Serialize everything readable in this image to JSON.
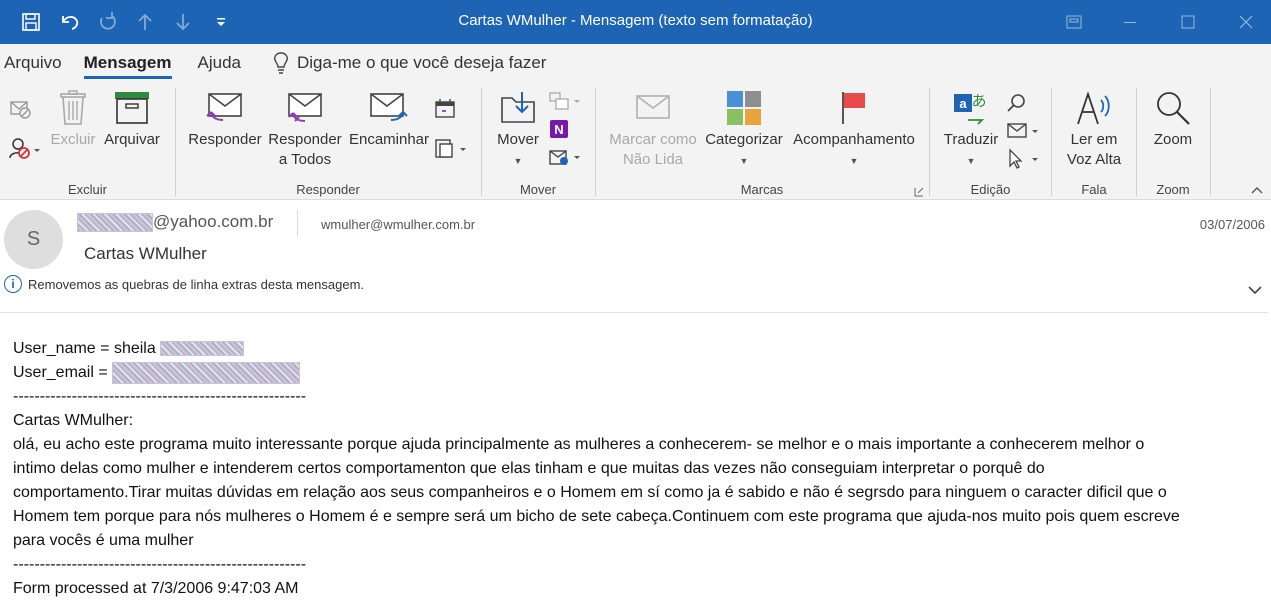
{
  "window": {
    "title": "Cartas WMulher  -  Mensagem (texto sem formatação)"
  },
  "tabs": [
    {
      "label": "Arquivo"
    },
    {
      "label": "Mensagem"
    },
    {
      "label": "Ajuda"
    }
  ],
  "tellme": {
    "label": "Diga-me o que você deseja fazer"
  },
  "ribbon": {
    "groups": {
      "excluir": "Excluir",
      "responder": "Responder",
      "mover": "Mover",
      "marcas": "Marcas",
      "edicao": "Edição",
      "fala": "Fala",
      "zoom": "Zoom"
    },
    "buttons": {
      "excluir": "Excluir",
      "arquivar": "Arquivar",
      "responder": "Responder",
      "responder_todos_1": "Responder",
      "responder_todos_2": "a Todos",
      "encaminhar": "Encaminhar",
      "mover": "Mover",
      "marcar_1": "Marcar como",
      "marcar_2": "Não Lida",
      "categorizar": "Categorizar",
      "acompanhamento": "Acompanhamento",
      "traduzir": "Traduzir",
      "ler_1": "Ler em",
      "ler_2": "Voz Alta",
      "zoom": "Zoom"
    }
  },
  "message": {
    "avatar_initial": "S",
    "from_domain": "@yahoo.com.br",
    "to": "wmulher@wmulher.com.br",
    "date": "03/07/2006",
    "subject": "Cartas WMulher",
    "info_notice": "Removemos as quebras de linha extras desta mensagem.",
    "body": {
      "user_name_label": "User_name   = sheila",
      "user_email_label": "User_email   =",
      "dashes": "-------------------------------------------------------",
      "heading": "Cartas WMulher:",
      "lines": [
        "olá, eu acho este programa muito interessante porque ajuda principalmente as mulheres a conhecerem- se melhor e o mais importante a conhecerem melhor o",
        "intimo delas como mulher e intenderem certos comportamenton que elas tinham e que muitas das vezes não conseguiam interpretar o porquê do",
        "comportamento.Tirar muitas dúvidas em relação aos seus companheiros e o Homem em sí como ja é sabido e não é segrsdo para ninguem o caracter dificil que o",
        "Homem tem porque para nós mulheres o Homem é e sempre será um bicho de sete cabeça.Continuem com este programa que ajuda-nos muito pois quem escreve",
        "para vocês é uma mulher"
      ],
      "footer": "Form processed at 7/3/2006 9:47:03 AM"
    }
  },
  "colors": {
    "titlebar": "#1e64b4",
    "ribbon_bg": "#f3f3f3",
    "accent": "#1e64b4"
  }
}
